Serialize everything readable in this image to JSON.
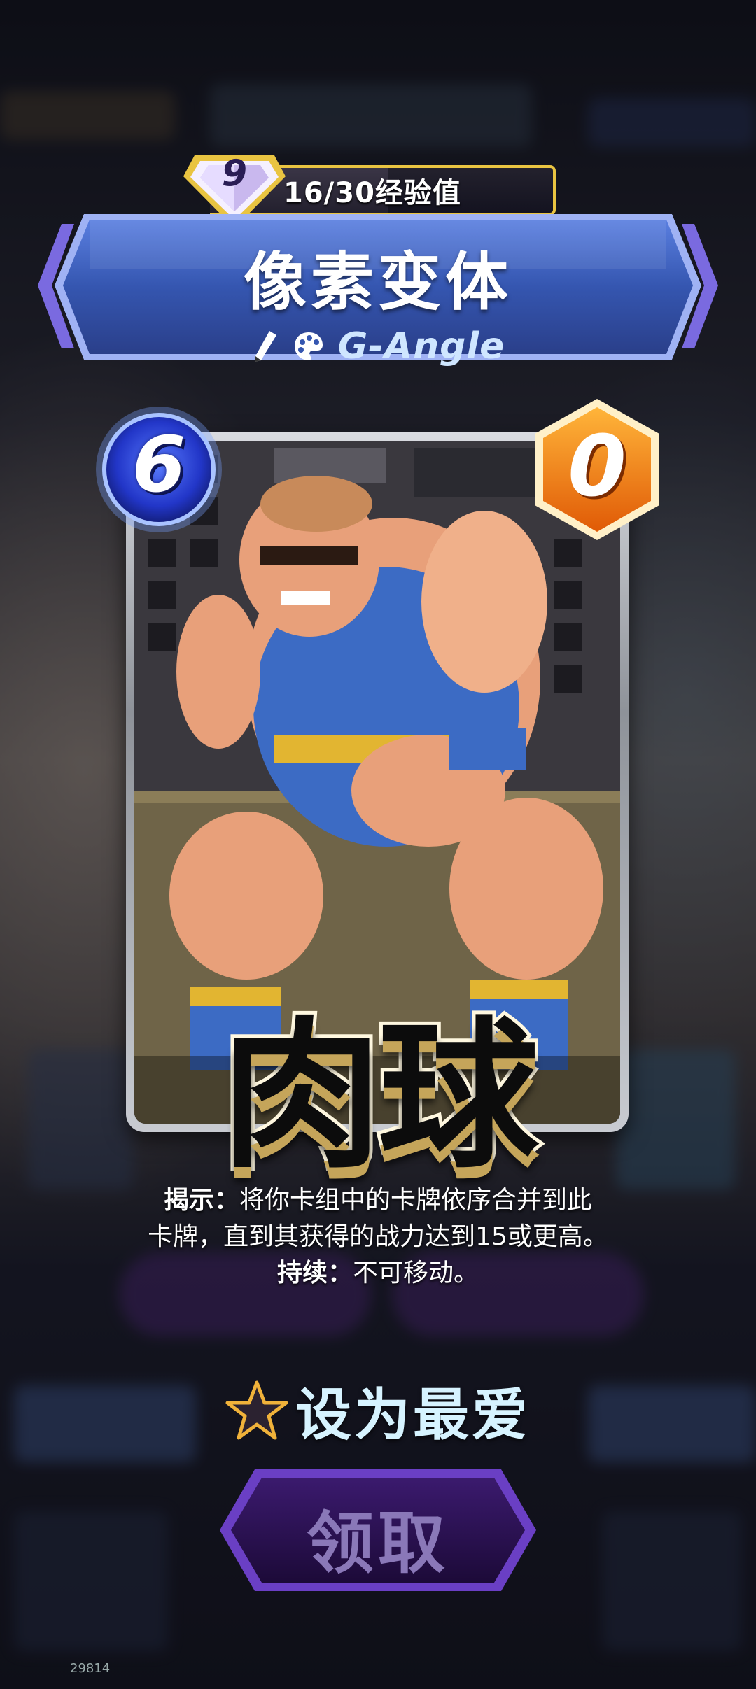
{
  "card": {
    "level": "9",
    "exp_text": "16/30经验值",
    "title": "像素变体",
    "artist": "G-Angle",
    "cost": "6",
    "power": "0",
    "name": "肉球"
  },
  "ability": {
    "reveal_label": "揭示：",
    "reveal_text_line1": "将你卡组中的卡牌依序合并到此",
    "reveal_text_line2": "卡牌，直到其获得的战力达到15或更高。",
    "ongoing_label": "持续：",
    "ongoing_text": "不可移动。"
  },
  "actions": {
    "favorite_label": "设为最爱",
    "claim_label": "领取"
  },
  "watermark": "29814",
  "colors": {
    "cost_blue": "#2a4de0",
    "power_orange": "#f07a12",
    "banner_blue": "#3c5fb8",
    "gold": "#e9c441",
    "claim_purple": "#2b1250"
  }
}
